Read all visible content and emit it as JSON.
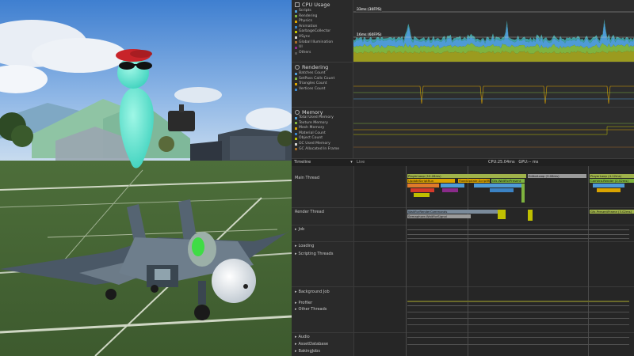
{
  "cpu": {
    "title": "CPU Usage",
    "legend": [
      {
        "label": "Scripts",
        "color": "#4e9bd6"
      },
      {
        "label": "Rendering",
        "color": "#7fb33f"
      },
      {
        "label": "Physics",
        "color": "#d9a300"
      },
      {
        "label": "Animation",
        "color": "#3b82c4"
      },
      {
        "label": "GarbageCollector",
        "color": "#bfbf00"
      },
      {
        "label": "VSync",
        "color": "#d4d4d4"
      },
      {
        "label": "Global Illumination",
        "color": "#a36b2b"
      },
      {
        "label": "UI",
        "color": "#8a2b8a"
      },
      {
        "label": "Others",
        "color": "#555555"
      }
    ],
    "marker_30": "33ms (30FPS)",
    "marker_60": "16ms (60FPS)"
  },
  "rendering": {
    "title": "Rendering",
    "legend": [
      {
        "label": "Batches Count",
        "color": "#4e9bd6"
      },
      {
        "label": "SetPass Calls Count",
        "color": "#7fb33f"
      },
      {
        "label": "Triangles Count",
        "color": "#d9a300"
      },
      {
        "label": "Vertices Count",
        "color": "#3b82c4"
      }
    ]
  },
  "memory": {
    "title": "Memory",
    "legend": [
      {
        "label": "Total Used Memory",
        "color": "#4e9bd6"
      },
      {
        "label": "Texture Memory",
        "color": "#7fb33f"
      },
      {
        "label": "Mesh Memory",
        "color": "#d9a300"
      },
      {
        "label": "Material Count",
        "color": "#3b82c4"
      },
      {
        "label": "Object Count",
        "color": "#bfbf00"
      },
      {
        "label": "GC Used Memory",
        "color": "#d4d4d4"
      },
      {
        "label": "GC Allocated In Frame",
        "color": "#a36b2b"
      }
    ]
  },
  "timeline": {
    "view_label": "Timeline",
    "live_label": "Live",
    "stats": "CPU:25.04ms   GPU:-- ms",
    "threads": {
      "main": "Main Thread",
      "render": "Render Thread",
      "job": "Job",
      "loading": "Loading",
      "scripting": "Scripting Threads",
      "background": "Background Job",
      "profiler": "Profiler",
      "other": "Other Threads",
      "audio": "Audio",
      "asset_db": "AssetDatabase",
      "baking": "BakingJobs"
    },
    "blocks": {
      "playerloop": "PlayerLoop (10.26ms)",
      "editorloop": "EditorLoop (3.08ms)",
      "playerloop2": "PlayerLoop (4.12ms)",
      "update_script": "UpdateScriptRun",
      "fixed_update": "FixedUpdate.ScriptRun",
      "gfx_wait": "Gfx.WaitForPresent",
      "camera_render": "Camera.Render (2.52ms)",
      "wait_commands": "WaitForRenderCommands",
      "semaphore": "Semaphore.WaitForSignal",
      "gfx_present": "Gfx.PresentFrame (3.02ms)"
    }
  }
}
